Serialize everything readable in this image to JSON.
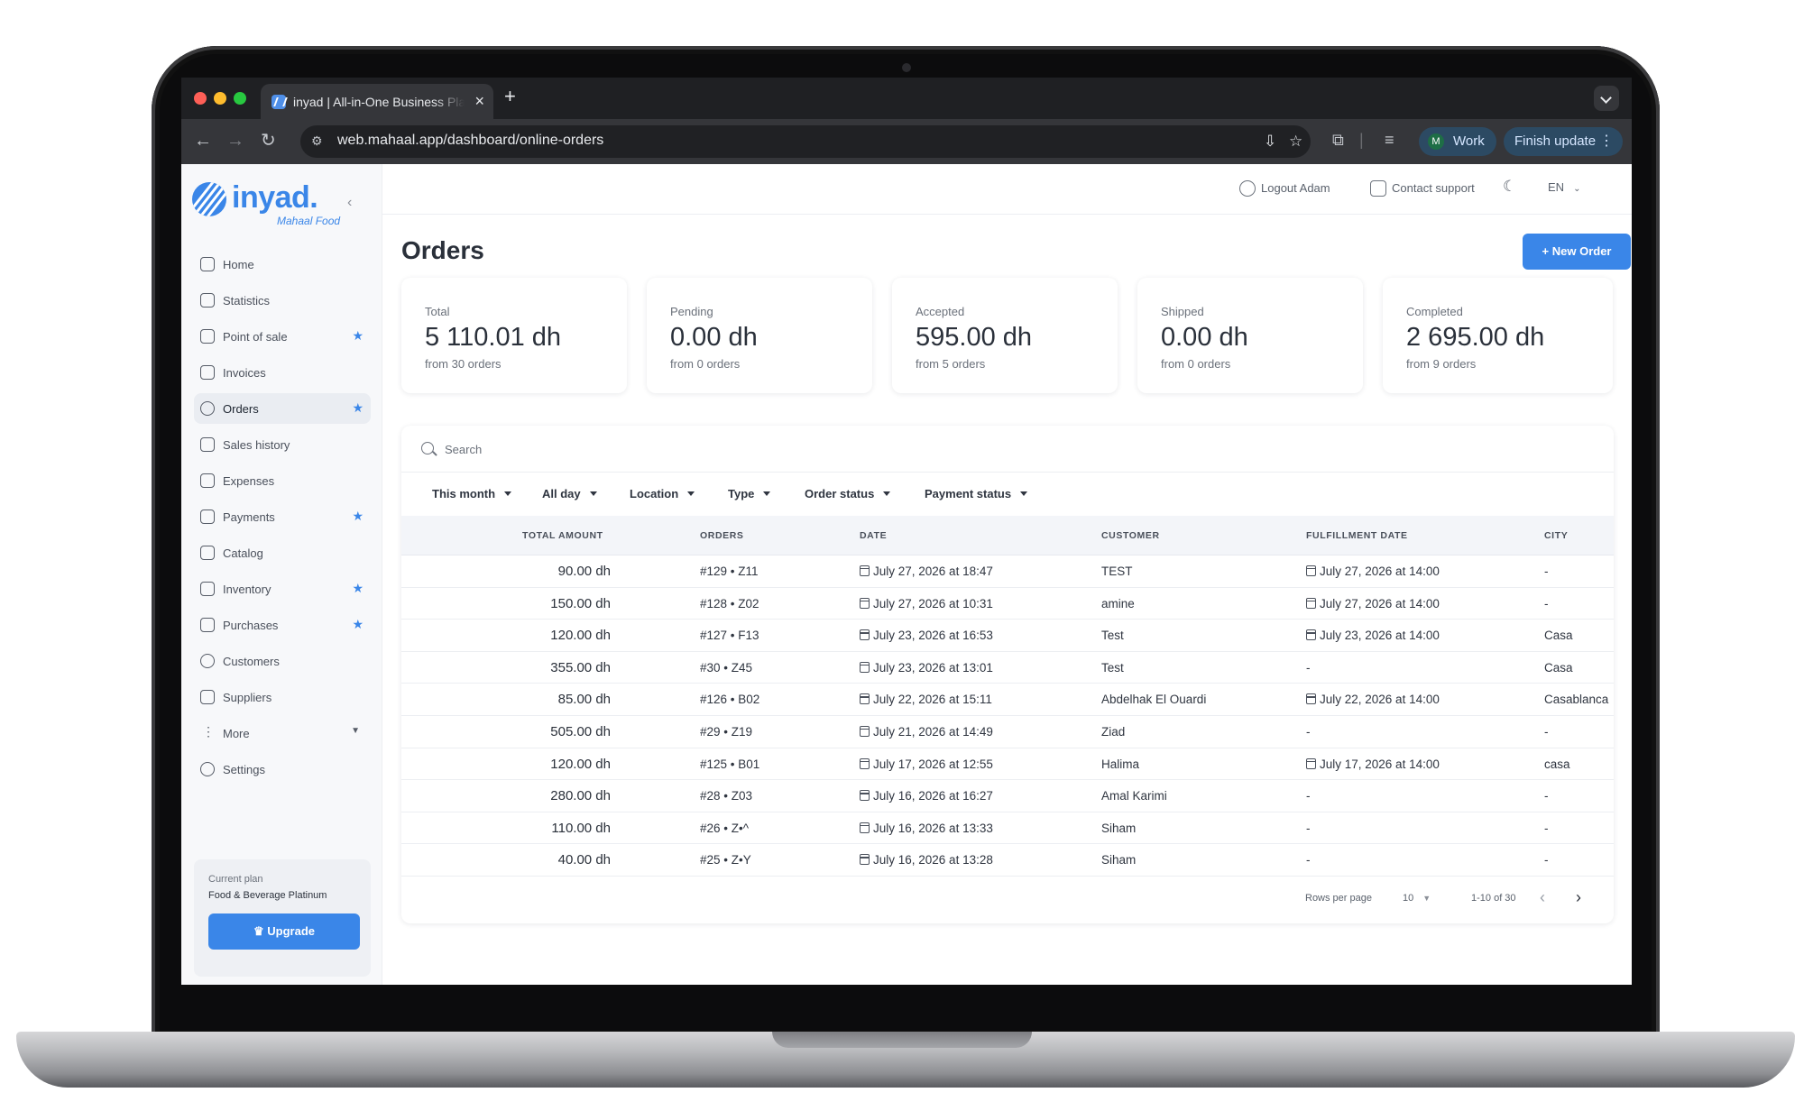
{
  "browser": {
    "tab_title": "inyad | All-in-One Business Platform",
    "new_tab": "+",
    "url": "web.mahaal.app/dashboard/online-orders",
    "profile_initial": "M",
    "profile_label": "Work",
    "finish_update_label": "Finish update"
  },
  "brand": {
    "name": "inyad.",
    "tagline": "Mahaal Food",
    "accent_color": "#3a86e8"
  },
  "sidebar": {
    "items": [
      {
        "label": "Home",
        "icon": "home-icon",
        "starred": false
      },
      {
        "label": "Statistics",
        "icon": "chart-icon",
        "starred": false
      },
      {
        "label": "Point of sale",
        "icon": "monitor-icon",
        "starred": true
      },
      {
        "label": "Invoices",
        "icon": "document-icon",
        "starred": false
      },
      {
        "label": "Orders",
        "icon": "globe-icon",
        "starred": true,
        "active": true
      },
      {
        "label": "Sales history",
        "icon": "receipt-icon",
        "starred": false
      },
      {
        "label": "Expenses",
        "icon": "wallet-icon",
        "starred": false
      },
      {
        "label": "Payments",
        "icon": "payment-icon",
        "starred": true
      },
      {
        "label": "Catalog",
        "icon": "grid-icon",
        "starred": false
      },
      {
        "label": "Inventory",
        "icon": "box-icon",
        "starred": true
      },
      {
        "label": "Purchases",
        "icon": "cart-icon",
        "starred": true
      },
      {
        "label": "Customers",
        "icon": "user-icon",
        "starred": false
      },
      {
        "label": "Suppliers",
        "icon": "truck-icon",
        "starred": false
      },
      {
        "label": "More",
        "icon": "more-icon",
        "starred": false,
        "expandable": true
      },
      {
        "label": "Settings",
        "icon": "gear-icon",
        "starred": false
      }
    ],
    "plan_caption": "Current plan",
    "plan_name": "Food & Beverage Platinum",
    "upgrade_label": "Upgrade"
  },
  "topbar": {
    "logout_label": "Logout Adam",
    "support_label": "Contact support",
    "language": "EN"
  },
  "page": {
    "title": "Orders",
    "new_order_label": "New Order"
  },
  "stats": [
    {
      "label": "Total",
      "value": "5 110.01 dh",
      "sub": "from 30 orders"
    },
    {
      "label": "Pending",
      "value": "0.00 dh",
      "sub": "from 0 orders"
    },
    {
      "label": "Accepted",
      "value": "595.00 dh",
      "sub": "from 5 orders"
    },
    {
      "label": "Shipped",
      "value": "0.00 dh",
      "sub": "from 0 orders"
    },
    {
      "label": "Completed",
      "value": "2 695.00 dh",
      "sub": "from 9 orders"
    }
  ],
  "search": {
    "placeholder": "Search"
  },
  "filters": [
    "This month",
    "All day",
    "Location",
    "Type",
    "Order status",
    "Payment status"
  ],
  "table": {
    "columns": [
      "TOTAL AMOUNT",
      "ORDERS",
      "DATE",
      "CUSTOMER",
      "FULFILLMENT DATE",
      "CITY"
    ],
    "rows": [
      {
        "amount": "90.00 dh",
        "order": "#129 • Z11",
        "date": "July 27, 2026 at 18:47",
        "customer": "TEST",
        "fulfillment": "July 27, 2026 at 14:00",
        "city": "-"
      },
      {
        "amount": "150.00 dh",
        "order": "#128 • Z02",
        "date": "July 27, 2026 at 10:31",
        "customer": "amine",
        "fulfillment": "July 27, 2026 at 14:00",
        "city": "-"
      },
      {
        "amount": "120.00 dh",
        "order": "#127 • F13",
        "date": "July 23, 2026 at 16:53",
        "customer": "Test",
        "fulfillment": "July 23, 2026 at 14:00",
        "city": "Casa"
      },
      {
        "amount": "355.00 dh",
        "order": "#30 • Z45",
        "date": "July 23, 2026 at 13:01",
        "customer": "Test",
        "fulfillment": "-",
        "city": "Casa"
      },
      {
        "amount": "85.00 dh",
        "order": "#126 • B02",
        "date": "July 22, 2026 at 15:11",
        "customer": "Abdelhak El Ouardi",
        "fulfillment": "July 22, 2026 at 14:00",
        "city": "Casablanca"
      },
      {
        "amount": "505.00 dh",
        "order": "#29 • Z19",
        "date": "July 21, 2026 at 14:49",
        "customer": "Ziad",
        "fulfillment": "-",
        "city": "-"
      },
      {
        "amount": "120.00 dh",
        "order": "#125 • B01",
        "date": "July 17, 2026 at 12:55",
        "customer": "Halima",
        "fulfillment": "July 17, 2026 at 14:00",
        "city": "casa"
      },
      {
        "amount": "280.00 dh",
        "order": "#28 • Z03",
        "date": "July 16, 2026 at 16:27",
        "customer": "Amal Karimi",
        "fulfillment": "-",
        "city": "-"
      },
      {
        "amount": "110.00 dh",
        "order": "#26 • Z•^",
        "date": "July 16, 2026 at 13:33",
        "customer": "Siham",
        "fulfillment": "-",
        "city": "-"
      },
      {
        "amount": "40.00 dh",
        "order": "#25 • Z•Y",
        "date": "July 16, 2026 at 13:28",
        "customer": "Siham",
        "fulfillment": "-",
        "city": "-"
      }
    ]
  },
  "pagination": {
    "rows_per_page_label": "Rows per page",
    "rows_per_page": "10",
    "range": "1-10 of 30"
  }
}
